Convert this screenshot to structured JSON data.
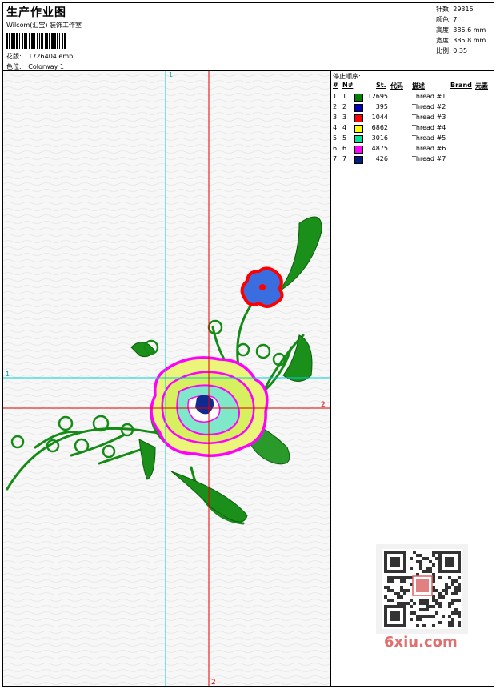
{
  "header": {
    "title": "生产作业图",
    "company": "Wilcom(汇宝) 装饰工作室",
    "design_label": "花版:",
    "design_value": "1726404.emb",
    "colorway_label": "色位:",
    "colorway_value": "Colorway 1"
  },
  "stats": {
    "stitches_label": "针数:",
    "stitches_value": "29315",
    "colors_label": "颜色:",
    "colors_value": "7",
    "height_label": "高度:",
    "height_value": "386.6 mm",
    "width_label": "宽度:",
    "width_value": "385.8 mm",
    "scale_label": "比例:",
    "scale_value": "0.35"
  },
  "threads": {
    "title": "停止顺序:",
    "headers": {
      "hash": "#",
      "no": "N#",
      "st": "St.",
      "code": "代码",
      "desc": "描述",
      "brand": "Brand",
      "element": "元素"
    },
    "rows": [
      {
        "index": "1.",
        "no": "1",
        "color": "#008000",
        "st": "12695",
        "desc": "Thread #1"
      },
      {
        "index": "2.",
        "no": "2",
        "color": "#0000c0",
        "st": "395",
        "desc": "Thread #2"
      },
      {
        "index": "3.",
        "no": "3",
        "color": "#ff0000",
        "st": "1044",
        "desc": "Thread #3"
      },
      {
        "index": "4.",
        "no": "4",
        "color": "#ffff00",
        "st": "6862",
        "desc": "Thread #4"
      },
      {
        "index": "5.",
        "no": "5",
        "color": "#00e0a0",
        "st": "3016",
        "desc": "Thread #5"
      },
      {
        "index": "6.",
        "no": "6",
        "color": "#ff00ff",
        "st": "4875",
        "desc": "Thread #6"
      },
      {
        "index": "7.",
        "no": "7",
        "color": "#002080",
        "st": "426",
        "desc": "Thread #7"
      }
    ]
  },
  "guides": {
    "cyan_label": "1",
    "red_label": "2"
  },
  "watermark": {
    "text": "6xiu.com"
  }
}
